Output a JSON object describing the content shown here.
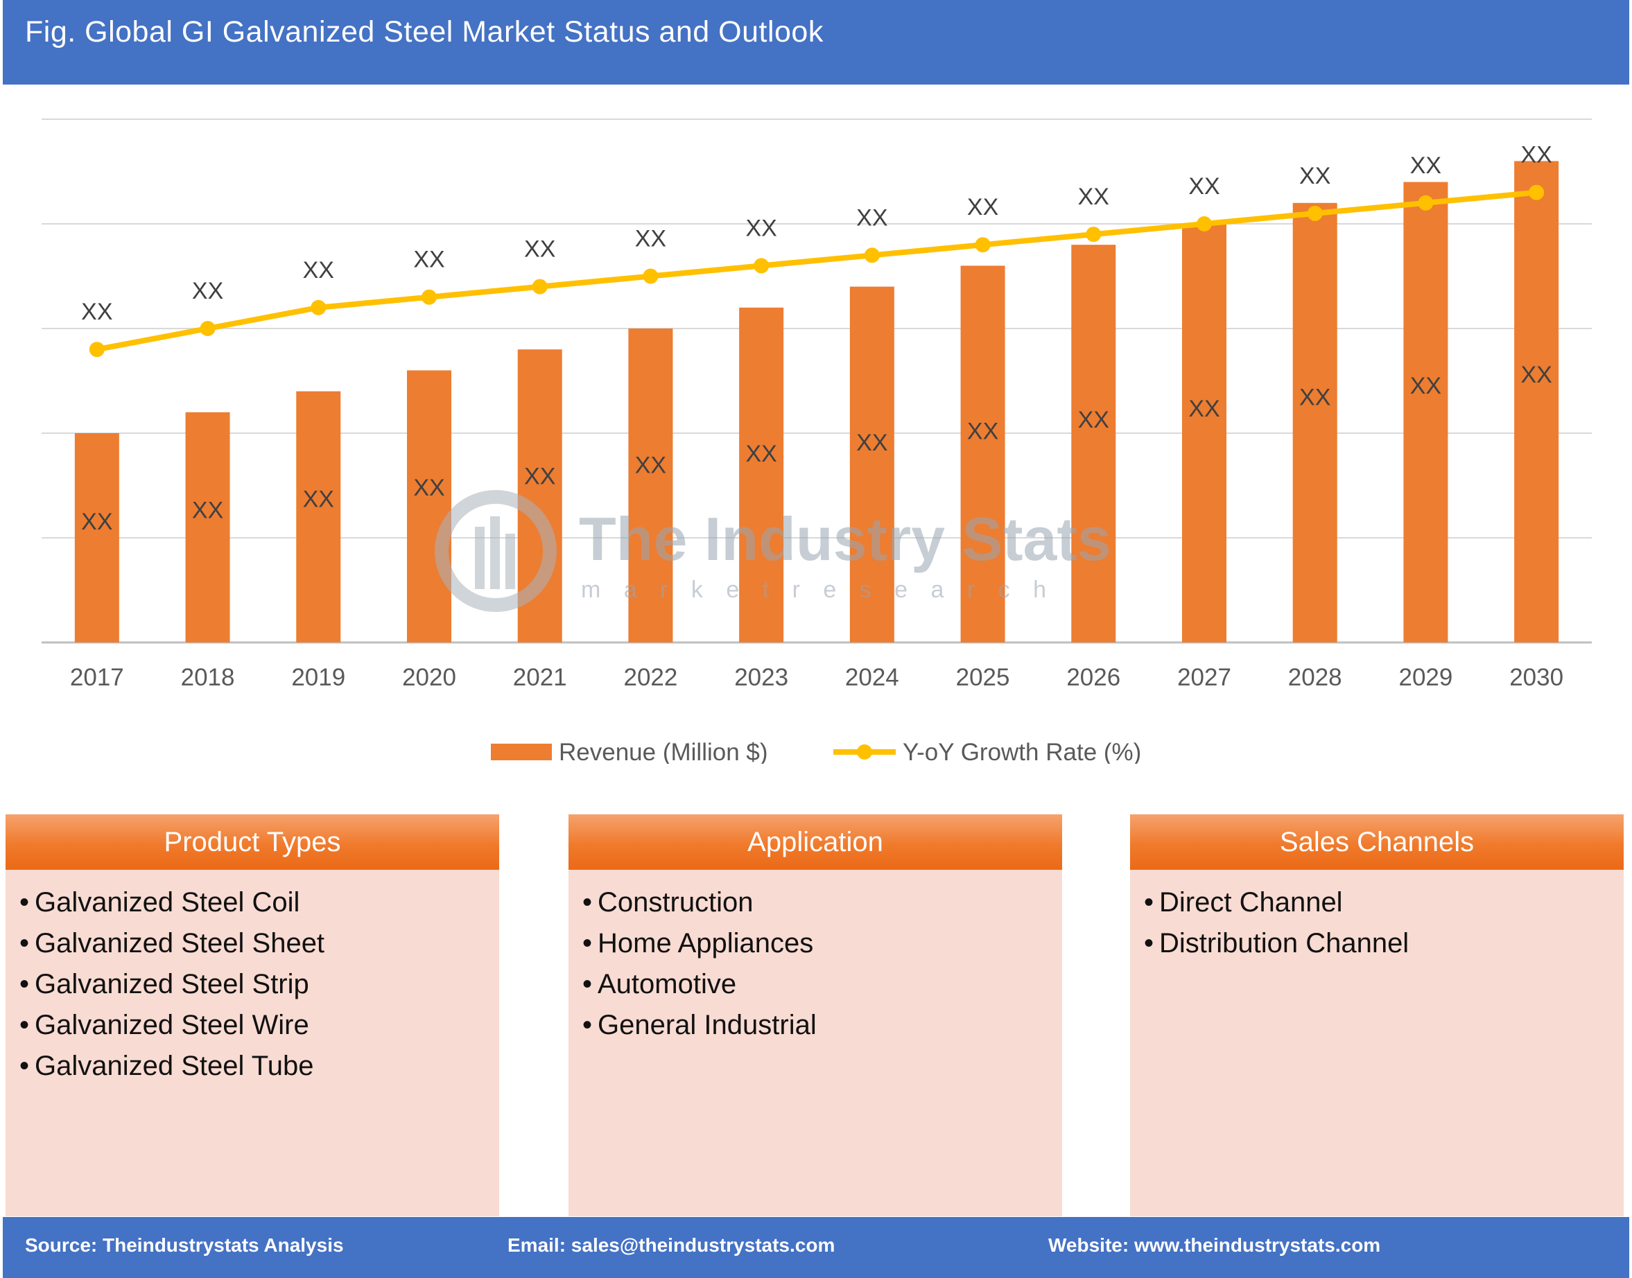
{
  "header": {
    "title": "Fig. Global GI Galvanized Steel Market Status and Outlook"
  },
  "chart_data": {
    "type": "bar",
    "categories": [
      "2017",
      "2018",
      "2019",
      "2020",
      "2021",
      "2022",
      "2023",
      "2024",
      "2025",
      "2026",
      "2027",
      "2028",
      "2029",
      "2030"
    ],
    "series": [
      {
        "name": "Revenue (Million $)",
        "kind": "bar",
        "color": "#ed7d31",
        "values": [
          2.0,
          2.2,
          2.4,
          2.6,
          2.8,
          3.0,
          3.2,
          3.4,
          3.6,
          3.8,
          4.0,
          4.2,
          4.4,
          4.6
        ],
        "labels": [
          "XX",
          "XX",
          "XX",
          "XX",
          "XX",
          "XX",
          "XX",
          "XX",
          "XX",
          "XX",
          "XX",
          "XX",
          "XX",
          "XX"
        ]
      },
      {
        "name": "Y-oY Growth Rate (%)",
        "kind": "line",
        "color": "#ffc000",
        "values": [
          2.8,
          3.0,
          3.2,
          3.3,
          3.4,
          3.5,
          3.6,
          3.7,
          3.8,
          3.9,
          4.0,
          4.1,
          4.2,
          4.3
        ],
        "labels": [
          "XX",
          "XX",
          "XX",
          "XX",
          "XX",
          "XX",
          "XX",
          "XX",
          "XX",
          "XX",
          "XX",
          "XX",
          "XX",
          "XX"
        ]
      }
    ],
    "ylim": [
      0,
      5
    ],
    "grid": true,
    "legend_position": "bottom",
    "xlabel": "",
    "ylabel": ""
  },
  "watermark": {
    "name": "The Industry Stats",
    "tagline": "m a r k e t   r e s e a r c h"
  },
  "panels": [
    {
      "title": "Product Types",
      "bullet": "•",
      "items": [
        "Galvanized Steel Coil",
        "Galvanized Steel Sheet",
        "Galvanized Steel Strip",
        "Galvanized Steel Wire",
        "Galvanized Steel Tube"
      ]
    },
    {
      "title": "Application",
      "bullet": "•",
      "items": [
        "Construction",
        "Home Appliances",
        "Automotive",
        "General Industrial"
      ]
    },
    {
      "title": "Sales Channels",
      "bullet": "•",
      "items": [
        "Direct Channel",
        "Distribution Channel"
      ]
    }
  ],
  "footer": {
    "source": "Source: Theindustrystats Analysis",
    "email": "Email: sales@theindustrystats.com",
    "website": "Website: www.theindustrystats.com"
  }
}
